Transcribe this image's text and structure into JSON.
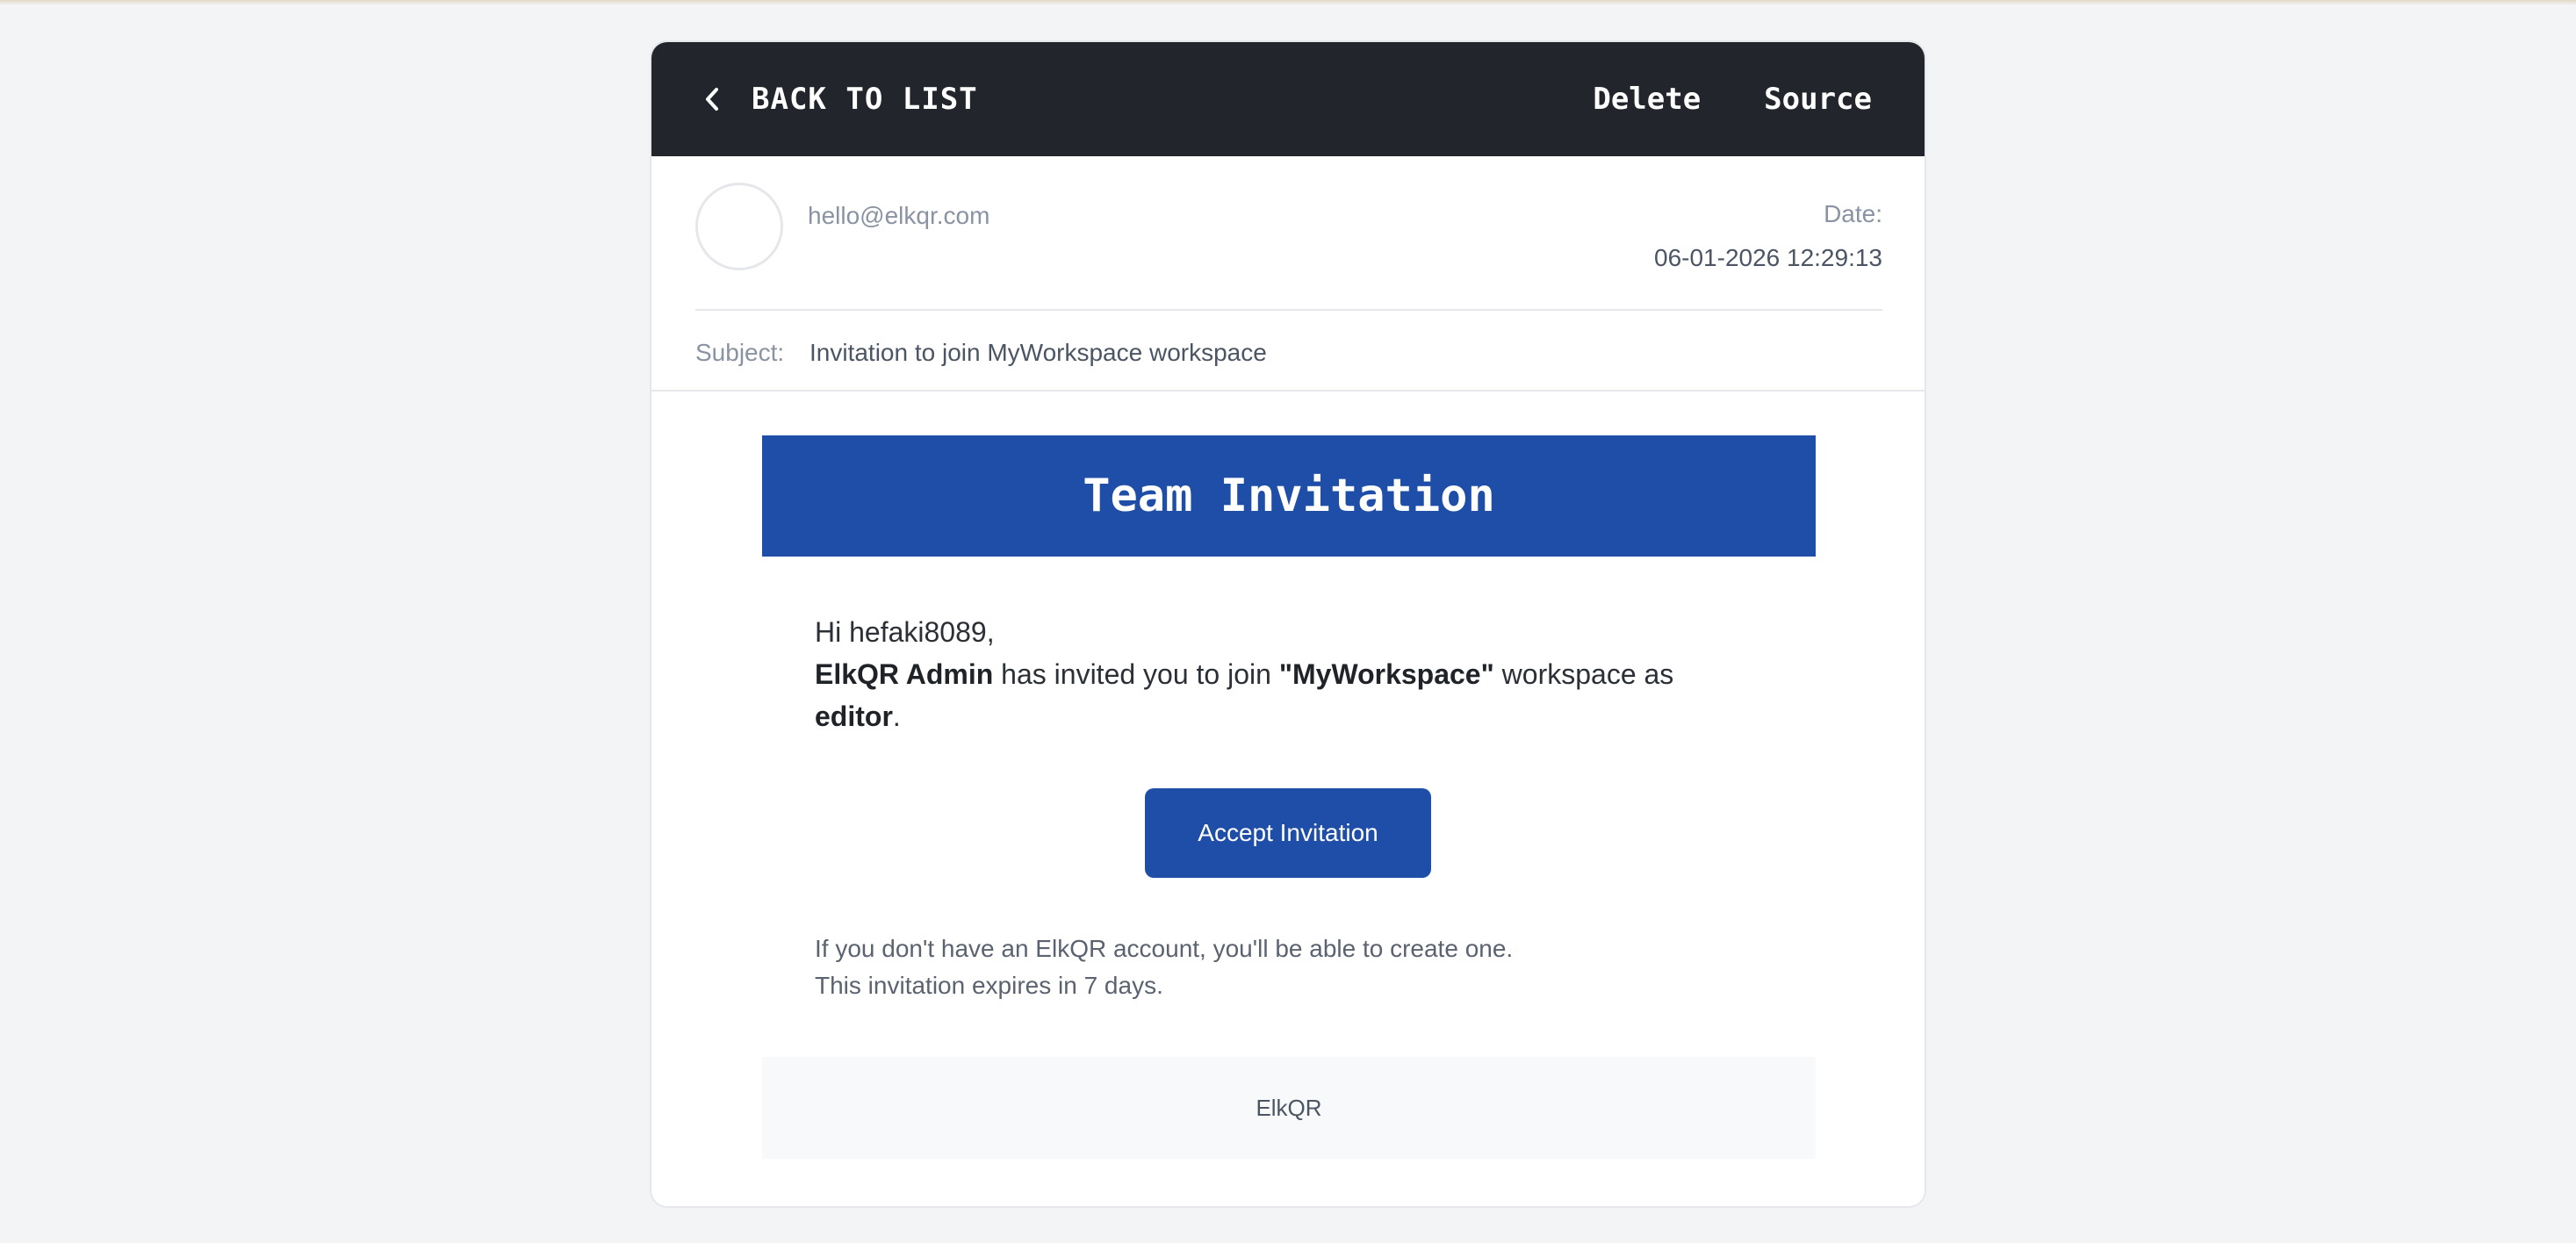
{
  "toolbar": {
    "back_label": "BACK TO LIST",
    "back_icon": "chevron-left-icon",
    "delete_label": "Delete",
    "source_label": "Source"
  },
  "email": {
    "from": "hello@elkqr.com",
    "date_label": "Date:",
    "date_value": "06-01-2026 12:29:13",
    "subject_label": "Subject:",
    "subject_value": "Invitation to join MyWorkspace workspace"
  },
  "content": {
    "banner_title": "Team Invitation",
    "greeting": "Hi hefaki8089,",
    "inviter": "ElkQR Admin",
    "invite_text": " has invited you to join ",
    "workspace": "\"MyWorkspace\"",
    "as_text": " workspace as ",
    "role": "editor",
    "period": ".",
    "accept_label": "Accept Invitation",
    "note_line1": "If you don't have an ElkQR account, you'll be able to create one.",
    "note_line2": "This invitation expires in 7 days.",
    "footer": "ElkQR"
  },
  "colors": {
    "toolbar_bg": "#22252b",
    "accent": "#1e4ea8"
  }
}
